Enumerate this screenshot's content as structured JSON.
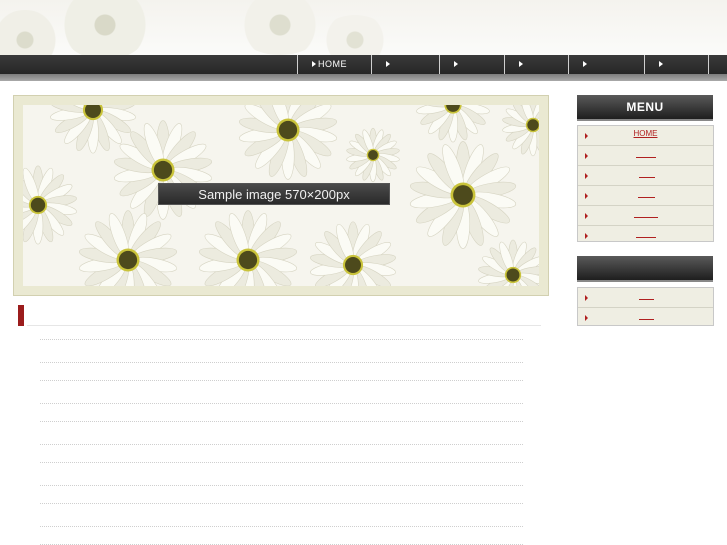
{
  "nav": {
    "items": [
      {
        "label": "HOME"
      },
      {
        "label": ""
      },
      {
        "label": ""
      },
      {
        "label": ""
      },
      {
        "label": ""
      },
      {
        "label": ""
      }
    ]
  },
  "hero": {
    "label": "Sample image 570×200px"
  },
  "section": {
    "title": ""
  },
  "sidebar": {
    "menu_title": "MENU",
    "menu_items": [
      {
        "label": "HOME"
      },
      {
        "label": ""
      },
      {
        "label": ""
      },
      {
        "label": ""
      },
      {
        "label": ""
      },
      {
        "label": ""
      }
    ],
    "box2_title": "",
    "box2_items": [
      {
        "label": ""
      },
      {
        "label": ""
      }
    ]
  },
  "colors": {
    "accent": "#9b1c1c",
    "nav_bg": "#2c2c2c",
    "frame_bg": "#eae9d2",
    "sidebar_bg": "#efeee3"
  },
  "icons": {
    "nav": "triangle-right-icon",
    "sidebar": "arrow-right-icon"
  }
}
